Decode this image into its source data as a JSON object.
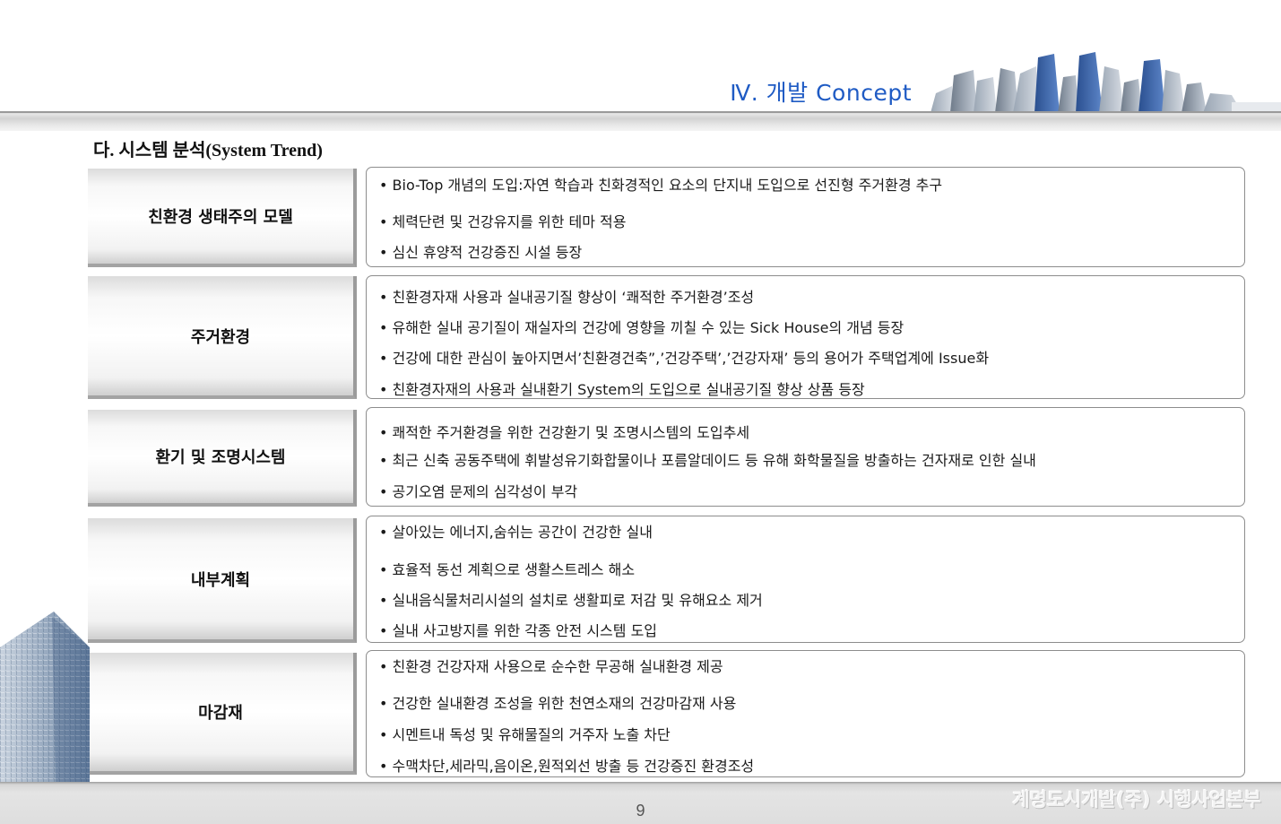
{
  "header": {
    "title": "Ⅳ.  개발 Concept"
  },
  "section_title": "다. 시스템 분석(System Trend)",
  "rows": [
    {
      "label": "친환경 생태주의 모델",
      "bullets": [
        "Bio-Top 개념의 도입:자연 학습과 친화경적인 요소의 단지내 도입으로 선진형 주거환경 추구",
        "체력단련 및 건강유지를 위한 테마 적용",
        "심신 휴양적 건강증진 시설 등장"
      ]
    },
    {
      "label": "주거환경",
      "bullets": [
        "친환경자재 사용과 실내공기질 향상이 ‘쾌적한 주거환경’조성",
        "유해한 실내 공기질이 재실자의 건강에 영향을 끼칠 수 있는 Sick House의 개념 등장",
        "건강에 대한 관심이 높아지면서’친환경건축”,’건강주택’,’건강자재’ 등의 용어가 주택업계에 Issue화",
        "친환경자재의 사용과 실내환기 System의 도입으로 실내공기질 향상 상품 등장"
      ]
    },
    {
      "label": "환기 및 조명시스템",
      "bullets": [
        "쾌적한 주거환경을 위한 건강환기 및 조명시스템의 도입추세",
        "최근 신축 공동주택에 휘발성유기화합물이나 포름알데이드 등 유해 화학물질을 방출하는 건자재로 인한 실내",
        "공기오염 문제의 심각성이 부각"
      ]
    },
    {
      "label": "내부계획",
      "bullets": [
        "살아있는 에너지,숨쉬는 공간이 건강한 실내",
        "효율적 동선 계획으로 생활스트레스 해소",
        "실내음식물처리시설의 설치로 생활피로 저감 및 유해요소 제거",
        "실내 사고방지를 위한 각종 안전 시스템 도입"
      ]
    },
    {
      "label": "마감재",
      "bullets": [
        "친환경 건강자재 사용으로 순수한 무공해 실내환경 제공",
        "건강한 실내환경 조성을 위한 천연소재의 건강마감재 사용",
        "시멘트내 독성 및 유해물질의 거주자 노출 차단",
        "수맥차단,세라믹,음이온,원적외선 방출 등 건강증진 환경조성"
      ]
    }
  ],
  "footer": {
    "page_number": "9",
    "company": "계명도시개발(주) 시행사업본부"
  }
}
